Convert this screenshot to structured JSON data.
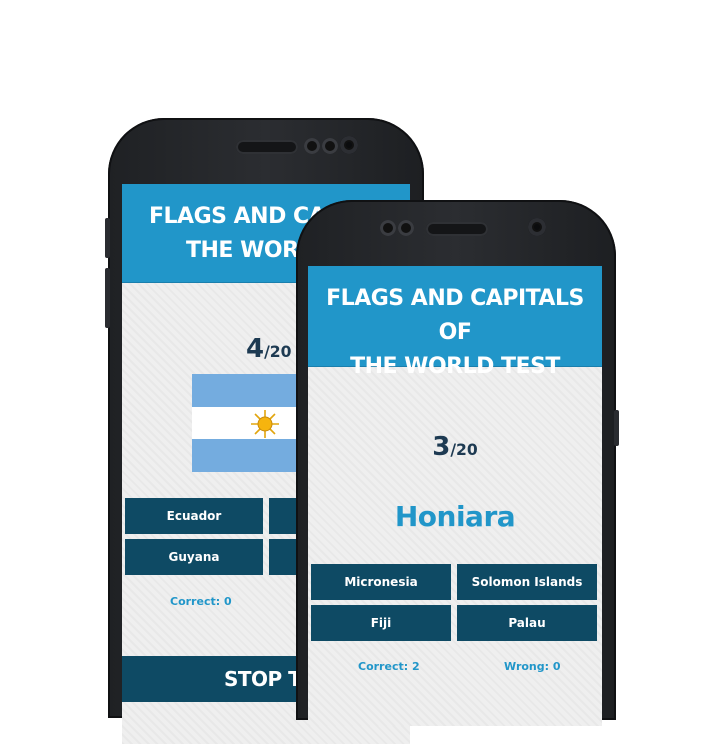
{
  "back_phone": {
    "header_title": "FLAGS AND CAPITALS OF THE WORLD TEST",
    "header_line1": "FLAGS AND CAPITA",
    "header_line2": "THE WORLD",
    "progress_current": "4",
    "progress_total": "/20",
    "flag_country": "Argentina",
    "answers": [
      "Ecuador",
      "Guyana"
    ],
    "correct_label": "Correct: 0",
    "stop_label": "STOP TES",
    "flag_colors": {
      "blue": "#74acdf",
      "white": "#ffffff",
      "sun": "#f6b40e"
    }
  },
  "front_phone": {
    "header_line1": "FLAGS AND CAPITALS OF",
    "header_line2": "THE WORLD TEST",
    "progress_current": "3",
    "progress_total": "/20",
    "question": "Honiara",
    "answers": [
      "Micronesia",
      "Solomon Islands",
      "Fiji",
      "Palau"
    ],
    "correct_label": "Correct: 2",
    "wrong_label": "Wrong: 0"
  },
  "colors": {
    "header": "#2196c9",
    "answer_bg": "#0e4a64",
    "accent_text": "#2196c9",
    "counter_text": "#1d3a52"
  }
}
